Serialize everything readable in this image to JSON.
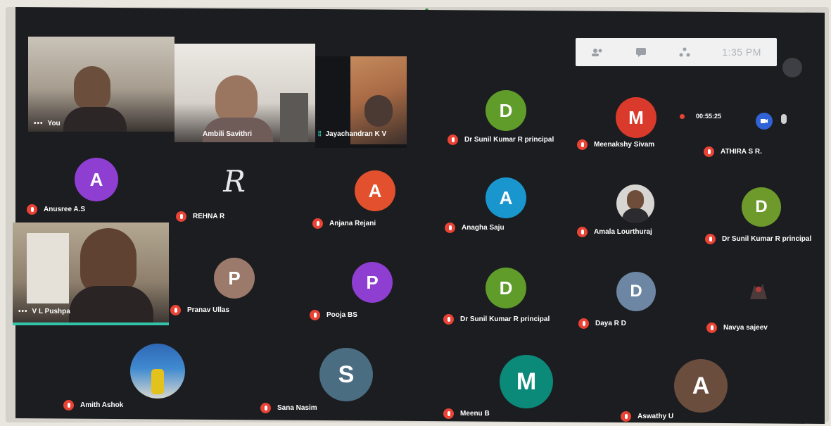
{
  "meeting": {
    "time": "1:35 PM",
    "recording_timer": "00:55:25",
    "toolbar_icons": [
      "people-icon",
      "chat-icon",
      "activities-icon"
    ]
  },
  "video_tiles": [
    {
      "label": "You",
      "has_menu": true
    },
    {
      "label": "Ambili Savithri",
      "has_menu": false
    },
    {
      "label": "Jayachandran K V",
      "has_menu": false
    },
    {
      "label": "V L Pushpa",
      "has_menu": true
    }
  ],
  "participants": [
    {
      "name": "Dr Sunil Kumar R principal",
      "initial": "D",
      "color": "#5f9c2a"
    },
    {
      "name": "Meenakshy Sivam",
      "initial": "M",
      "color": "#d93a2b"
    },
    {
      "name": "ATHIRA S R.",
      "initial": "",
      "color": ""
    },
    {
      "name": "Anusree A.S",
      "initial": "A",
      "color": "#8e3ed1"
    },
    {
      "name": "REHNA R",
      "initial": "R",
      "color": ""
    },
    {
      "name": "Anjana Rejani",
      "initial": "A",
      "color": "#e2502d"
    },
    {
      "name": "Anagha Saju",
      "initial": "A",
      "color": "#1a96cf"
    },
    {
      "name": "Amala Lourthuraj",
      "initial": "",
      "color": "#8a8a8a"
    },
    {
      "name": "Dr Sunil Kumar R principal",
      "initial": "D",
      "color": "#6e9a2c"
    },
    {
      "name": "Pranav Ullas",
      "initial": "P",
      "color": "#9c7a6b"
    },
    {
      "name": "Pooja BS",
      "initial": "P",
      "color": "#8e3ed1"
    },
    {
      "name": "Dr Sunil Kumar R principal",
      "initial": "D",
      "color": "#5f9c2a"
    },
    {
      "name": "Daya R D",
      "initial": "D",
      "color": "#6c86a3"
    },
    {
      "name": "Navya sajeev",
      "initial": "",
      "color": ""
    },
    {
      "name": "Amith Ashok",
      "initial": "",
      "color": ""
    },
    {
      "name": "Sana Nasim",
      "initial": "S",
      "color": "#4a6d82"
    },
    {
      "name": "Meenu B",
      "initial": "M",
      "color": "#0c8a79"
    },
    {
      "name": "Aswathy U",
      "initial": "A",
      "color": "#6b4d3e"
    }
  ]
}
